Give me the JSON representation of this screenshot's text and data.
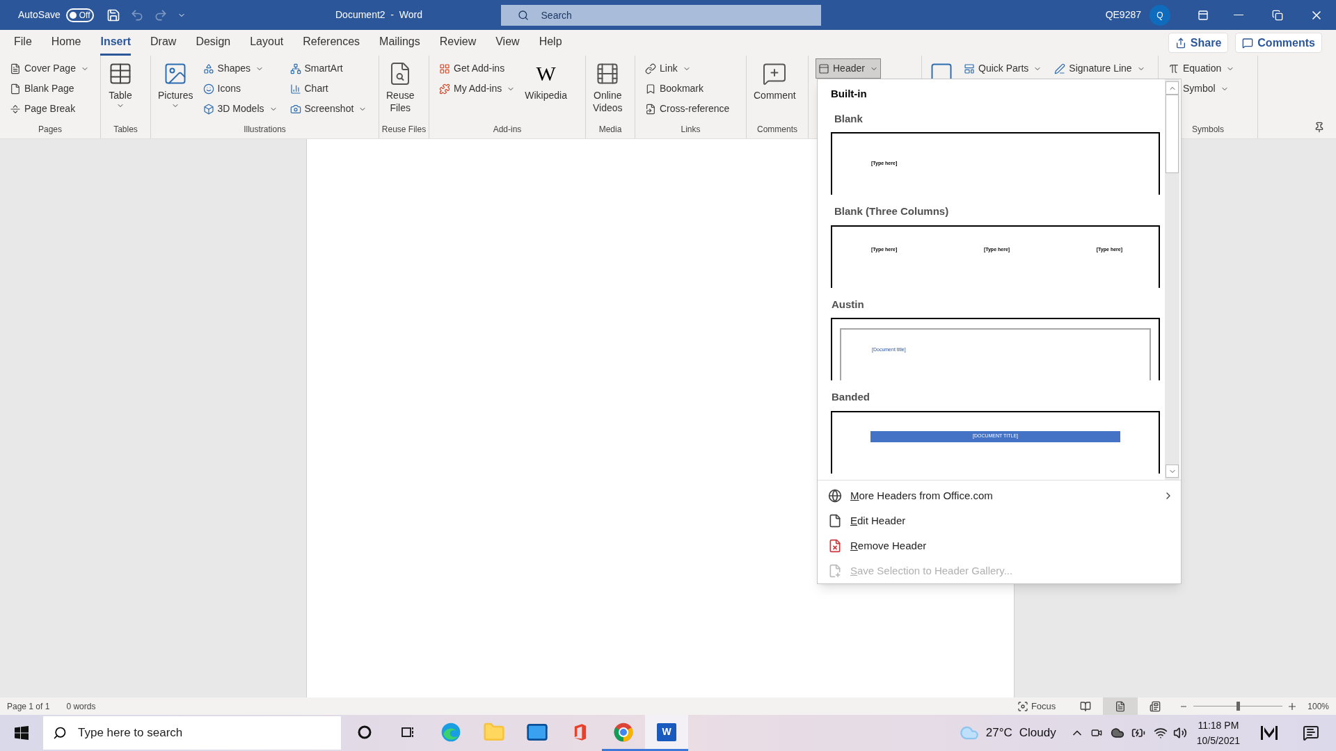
{
  "title_bar": {
    "autosave": {
      "label": "AutoSave",
      "state_text": "Off",
      "on": false
    },
    "quick_access": [
      {
        "kind": "save",
        "disabled": false
      },
      {
        "kind": "undo",
        "disabled": true
      },
      {
        "kind": "redo",
        "disabled": true
      },
      {
        "kind": "customize",
        "disabled": false
      }
    ],
    "document_title": "Document2  -  Word",
    "search": {
      "placeholder": "Search"
    },
    "user": "QE9287",
    "avatar": "Q"
  },
  "tabs": [
    {
      "label": "File",
      "selected": false
    },
    {
      "label": "Home",
      "selected": false
    },
    {
      "label": "Insert",
      "selected": true
    },
    {
      "label": "Draw",
      "selected": false
    },
    {
      "label": "Design",
      "selected": false
    },
    {
      "label": "Layout",
      "selected": false
    },
    {
      "label": "References",
      "selected": false
    },
    {
      "label": "Mailings",
      "selected": false
    },
    {
      "label": "Review",
      "selected": false
    },
    {
      "label": "View",
      "selected": false
    },
    {
      "label": "Help",
      "selected": false
    }
  ],
  "share_button": "Share",
  "comments_button": "Comments",
  "ribbon": {
    "groups": [
      {
        "label": "Pages",
        "columns": [
          {
            "kind": "stack",
            "items": [
              {
                "label": "Cover Page",
                "dropdown": true
              },
              {
                "label": "Blank Page",
                "dropdown": false
              },
              {
                "label": "Page Break",
                "dropdown": false
              }
            ]
          }
        ]
      },
      {
        "label": "Tables",
        "columns": [
          {
            "kind": "large",
            "label": "Table",
            "dropdown": true
          }
        ]
      },
      {
        "label": "Illustrations",
        "columns": [
          {
            "kind": "large",
            "label": "Pictures",
            "dropdown": true
          },
          {
            "kind": "stack",
            "items": [
              {
                "label": "Shapes",
                "dropdown": true
              },
              {
                "label": "Icons",
                "dropdown": false
              },
              {
                "label": "3D Models",
                "dropdown": true
              }
            ]
          },
          {
            "kind": "stack",
            "items": [
              {
                "label": "SmartArt",
                "dropdown": false
              },
              {
                "label": "Chart",
                "dropdown": false
              },
              {
                "label": "Screenshot",
                "dropdown": true
              }
            ]
          }
        ]
      },
      {
        "label": "Reuse Files",
        "columns": [
          {
            "kind": "large",
            "label": "Reuse Files",
            "dropdown": false
          }
        ]
      },
      {
        "label": "Add-ins",
        "columns": [
          {
            "kind": "stack",
            "items": [
              {
                "label": "Get Add-ins",
                "dropdown": false
              },
              {
                "label": "My Add-ins",
                "dropdown": true
              }
            ]
          },
          {
            "kind": "large",
            "label": "Wikipedia",
            "glyph": "W",
            "dropdown": false
          }
        ]
      },
      {
        "label": "Media",
        "columns": [
          {
            "kind": "large",
            "label": "Online Videos",
            "dropdown": false
          }
        ]
      },
      {
        "label": "Links",
        "columns": [
          {
            "kind": "stack",
            "items": [
              {
                "label": "Link",
                "dropdown": true
              },
              {
                "label": "Bookmark",
                "dropdown": false
              },
              {
                "label": "Cross-reference",
                "dropdown": false
              }
            ]
          }
        ]
      },
      {
        "label": "Comments",
        "columns": [
          {
            "kind": "large",
            "label": "Comment",
            "dropdown": false
          }
        ]
      },
      {
        "columns": [
          {
            "kind": "stack",
            "items": [
              {
                "label": "Header",
                "dropdown": true,
                "expanded": true
              }
            ]
          }
        ]
      },
      {
        "columns": [
          {
            "kind": "large"
          },
          {
            "kind": "stack",
            "items": [
              {
                "label": "Quick Parts",
                "dropdown": true
              }
            ]
          },
          {
            "kind": "stack",
            "items": [
              {
                "label": "Signature Line",
                "dropdown": true
              }
            ]
          }
        ]
      },
      {
        "label": "Symbols",
        "columns": [
          {
            "kind": "stack",
            "items": [
              {
                "label": "Equation",
                "dropdown": true
              },
              {
                "label": "Symbol",
                "dropdown": true
              }
            ]
          }
        ]
      }
    ]
  },
  "header_gallery": {
    "section": "Built-in",
    "items": [
      {
        "name": "Blank",
        "kind": "blank",
        "placeholders": [
          "[Type here]"
        ]
      },
      {
        "name": "Blank (Three Columns)",
        "kind": "three_columns",
        "placeholders": [
          "[Type here]",
          "[Type here]",
          "[Type here]"
        ]
      },
      {
        "name": "Austin",
        "kind": "austin",
        "placeholders": [
          "[Document title]"
        ]
      },
      {
        "name": "Banded",
        "kind": "banded",
        "placeholders": [
          "[DOCUMENT TITLE]"
        ]
      }
    ],
    "menu": [
      {
        "label": "More Headers from Office.com",
        "kind": "globe",
        "submenu": true,
        "disabled": false
      },
      {
        "label": "Edit Header",
        "kind": "edit",
        "submenu": false,
        "disabled": false
      },
      {
        "label": "Remove Header",
        "kind": "remove",
        "submenu": false,
        "disabled": false
      },
      {
        "label": "Save Selection to Header Gallery...",
        "kind": "save",
        "submenu": false,
        "disabled": true
      }
    ]
  },
  "status_bar": {
    "page": "Page 1 of 1",
    "words": "0 words",
    "focus": "Focus",
    "views": [
      {
        "kind": "read",
        "selected": false
      },
      {
        "kind": "print",
        "selected": true
      },
      {
        "kind": "web",
        "selected": false
      }
    ],
    "zoom": {
      "level": 0.5,
      "reading": "100%"
    }
  },
  "taskbar": {
    "search": {
      "placeholder": "Type here to search"
    },
    "apps": [
      {
        "kind": "cortana",
        "running": false,
        "selected": false
      },
      {
        "kind": "task_view",
        "running": false,
        "selected": false
      },
      {
        "kind": "edge",
        "running": false,
        "selected": false
      },
      {
        "kind": "explorer",
        "running": false,
        "selected": false
      },
      {
        "kind": "mail",
        "running": false,
        "selected": false
      },
      {
        "kind": "office",
        "running": false,
        "selected": false
      },
      {
        "kind": "chrome",
        "running": true,
        "selected": false
      },
      {
        "kind": "word",
        "glyph": "W",
        "running": true,
        "selected": true
      }
    ],
    "weather": {
      "temperature": "27°C",
      "condition": "Cloudy"
    },
    "time": "11:18 PM",
    "date": "10/5/2021"
  }
}
